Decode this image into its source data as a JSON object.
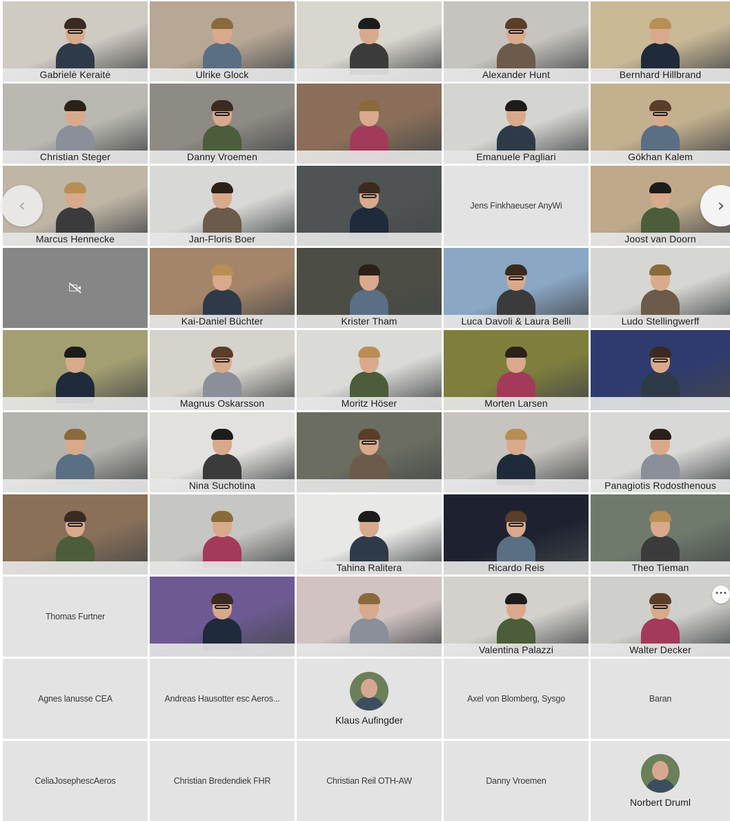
{
  "tiles": [
    {
      "kind": "video",
      "label": "Gabrielė Keraitė",
      "bg": "#cfcac2"
    },
    {
      "kind": "video",
      "label": "Ulrike Glock",
      "bg": "#b7a795",
      "selected": true
    },
    {
      "kind": "video",
      "label": "",
      "bg": "#d9d6cf"
    },
    {
      "kind": "video",
      "label": "Alexander Hunt",
      "bg": "#c6c4bf"
    },
    {
      "kind": "video",
      "label": "Bernhard Hillbrand",
      "bg": "#c9b997"
    },
    {
      "kind": "video",
      "label": "Christian Steger",
      "bg": "#b9b8b1"
    },
    {
      "kind": "video",
      "label": "Danny Vroemen",
      "bg": "#8e8a84"
    },
    {
      "kind": "video",
      "label": "",
      "bg": "#8a6e59"
    },
    {
      "kind": "video",
      "label": "Emanuele Pagliari",
      "bg": "#d4d4d0"
    },
    {
      "kind": "video",
      "label": "Gökhan Kalem",
      "bg": "#c3b08f"
    },
    {
      "kind": "video",
      "label": "Marcus Hennecke",
      "bg": "#bfb6a6"
    },
    {
      "kind": "video",
      "label": "Jan-Floris Boer",
      "bg": "#d8d8d6"
    },
    {
      "kind": "video",
      "label": "",
      "bg": "#505354"
    },
    {
      "kind": "audio",
      "label": "Jens Finkhaeuser AnyWi"
    },
    {
      "kind": "video",
      "label": "Joost van Doorn",
      "bg": "#bfa98a"
    },
    {
      "kind": "camoff",
      "label": ""
    },
    {
      "kind": "video",
      "label": "Kai-Daniel Büchter",
      "bg": "#a4856a"
    },
    {
      "kind": "video",
      "label": "Krister Tham",
      "bg": "#4c4d44"
    },
    {
      "kind": "video",
      "label": "Luca Davoli & Laura Belli",
      "bg": "#8aa7c4"
    },
    {
      "kind": "video",
      "label": "Ludo Stellingwerff",
      "bg": "#d6d6d2"
    },
    {
      "kind": "video",
      "label": "",
      "bg": "#a49f73"
    },
    {
      "kind": "video",
      "label": "Magnus Oskarsson",
      "bg": "#d6d3cc"
    },
    {
      "kind": "video",
      "label": "Moritz Höser",
      "bg": "#dadad7"
    },
    {
      "kind": "video",
      "label": "Morten Larsen",
      "bg": "#7e7f3d"
    },
    {
      "kind": "video",
      "label": "",
      "bg": "#2f3b6e"
    },
    {
      "kind": "video",
      "label": "",
      "bg": "#b4b4ae"
    },
    {
      "kind": "video",
      "label": "Nina Suchotina",
      "bg": "#e2e1dd"
    },
    {
      "kind": "video",
      "label": "",
      "bg": "#6a6d5f"
    },
    {
      "kind": "video",
      "label": "",
      "bg": "#c7c4bf"
    },
    {
      "kind": "video",
      "label": "Panagiotis Rodosthenous",
      "bg": "#d8d8d6"
    },
    {
      "kind": "video",
      "label": "",
      "bg": "#8a7059"
    },
    {
      "kind": "video",
      "label": "",
      "bg": "#c6c6c2"
    },
    {
      "kind": "video",
      "label": "Tahina Ralitera",
      "bg": "#e8e8e6"
    },
    {
      "kind": "video",
      "label": "Ricardo Reis",
      "bg": "#1e2230"
    },
    {
      "kind": "video",
      "label": "Theo Tieman",
      "bg": "#6f7a6c"
    },
    {
      "kind": "audio",
      "label": "Thomas Furtner"
    },
    {
      "kind": "video",
      "label": "",
      "bg": "#6d5a92"
    },
    {
      "kind": "video",
      "label": "",
      "bg": "#d0c3c2"
    },
    {
      "kind": "video",
      "label": "Valentina Palazzi",
      "bg": "#d3d1cc"
    },
    {
      "kind": "video",
      "label": "Walter Decker",
      "bg": "#cfcfcb"
    },
    {
      "kind": "audio",
      "label": "Agnes lanusse CEA"
    },
    {
      "kind": "audio",
      "label": "Andreas Hausotter esc Aeros..."
    },
    {
      "kind": "audio-avatar",
      "label": "Klaus Aufingder"
    },
    {
      "kind": "audio",
      "label": "Axel von Blomberg, Sysgo"
    },
    {
      "kind": "audio",
      "label": "Baran"
    },
    {
      "kind": "audio",
      "label": "CeliaJosephescAeros"
    },
    {
      "kind": "audio",
      "label": "Christian Bredendiek FHR"
    },
    {
      "kind": "audio",
      "label": "Christian Reil OTH-AW"
    },
    {
      "kind": "audio",
      "label": "Danny Vroemen"
    },
    {
      "kind": "audio-avatar",
      "label": "Norbert Druml"
    }
  ],
  "controls": {
    "prev_icon": "‹",
    "next_icon": "›",
    "more_icon": "•••"
  }
}
